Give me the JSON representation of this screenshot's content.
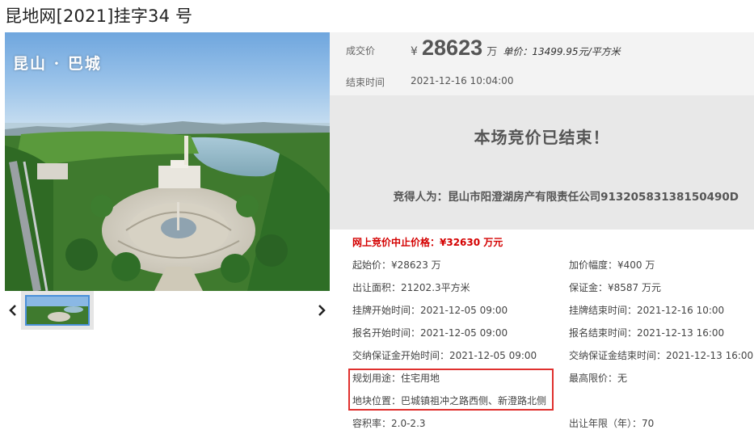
{
  "page": {
    "title": "昆地网[2021]挂字34 号"
  },
  "gallery": {
    "caption": "昆山 · 巴城",
    "prev_icon": "chevron-left-icon",
    "next_icon": "chevron-right-icon"
  },
  "deal": {
    "price_label": "成交价",
    "currency": "¥",
    "price": "28623",
    "price_unit": "万",
    "unit_price": "单价：13499.95元/平方米",
    "end_time_label": "结束时间",
    "end_time": "2021-12-16 10:04:00"
  },
  "status": {
    "ended_text": "本场竞价已结束！",
    "winner_text": "竞得人为：昆山市阳澄湖房产有限责任公司91320583138150490D"
  },
  "stop_price": "网上竞价中止价格：¥32630 万元",
  "fields": {
    "start_price": {
      "label": "起始价：",
      "value": "¥28623 万"
    },
    "increment": {
      "label": "加价幅度：",
      "value": "¥400 万"
    },
    "area": {
      "label": "出让面积：",
      "value": "21202.3平方米"
    },
    "deposit": {
      "label": "保证金：",
      "value": "¥8587 万元"
    },
    "listing_start": {
      "label": "挂牌开始时间：",
      "value": "2021-12-05 09:00"
    },
    "listing_end": {
      "label": "挂牌结束时间：",
      "value": "2021-12-16 10:00"
    },
    "signup_start": {
      "label": "报名开始时间：",
      "value": "2021-12-05 09:00"
    },
    "signup_end": {
      "label": "报名结束时间：",
      "value": "2021-12-13 16:00"
    },
    "deposit_start": {
      "label": "交纳保证金开始时间：",
      "value": "2021-12-05 09:00"
    },
    "deposit_end": {
      "label": "交纳保证金结束时间：",
      "value": "2021-12-13 16:00"
    },
    "land_use": {
      "label": "规划用途：",
      "value": "住宅用地"
    },
    "max_price": {
      "label": "最高限价：",
      "value": "无"
    },
    "location": {
      "label": "地块位置：",
      "value": "巴城镇祖冲之路西侧、新澄路北侧"
    },
    "plot_ratio": {
      "label": "容积率：",
      "value": "2.0-2.3"
    },
    "lease_years": {
      "label": "出让年限（年）：",
      "value": "70"
    }
  },
  "colors": {
    "stop_price": "#d40000",
    "highlight_border": "#e0302e",
    "thumb_border": "#4a90d9"
  }
}
